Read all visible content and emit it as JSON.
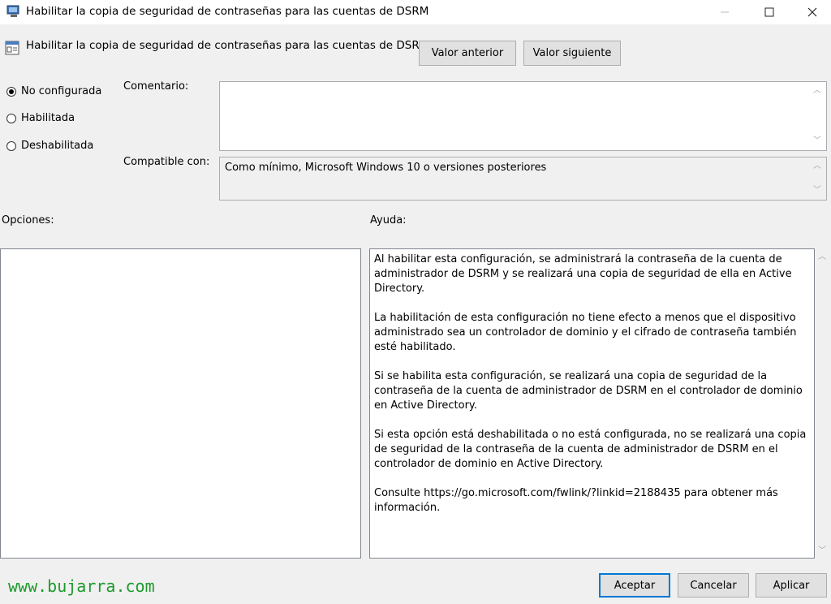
{
  "window": {
    "title": "Habilitar la copia de seguridad de contraseñas para las cuentas de DSRM",
    "app_icon": "policy-editor-icon",
    "controls": [
      "minimize-icon",
      "maximize-icon",
      "close-icon"
    ]
  },
  "header": {
    "policy_title": "Habilitar la copia de seguridad de contraseñas para las cuentas de DSRM",
    "prev_label": "Valor anterior",
    "next_label": "Valor siguiente"
  },
  "state": {
    "options": [
      {
        "label": "No configurada",
        "checked": true
      },
      {
        "label": "Habilitada",
        "checked": false
      },
      {
        "label": "Deshabilitada",
        "checked": false
      }
    ]
  },
  "comment": {
    "label": "Comentario:",
    "value": ""
  },
  "compatible": {
    "label": "Compatible con:",
    "value": "Como mínimo, Microsoft Windows 10 o versiones posteriores"
  },
  "options_panel": {
    "label": "Opciones:"
  },
  "help_panel": {
    "label": "Ayuda:",
    "paragraphs": [
      "Al habilitar esta configuración, se administrará la contraseña de la cuenta de administrador de DSRM y se realizará una copia de seguridad de ella en Active Directory.",
      "La habilitación de esta configuración no tiene efecto a menos que el dispositivo administrado sea un controlador de dominio y el cifrado de contraseña también esté habilitado.",
      "Si se habilita esta configuración, se realizará una copia de seguridad de la contraseña de la cuenta de administrador de DSRM en el controlador de dominio en Active Directory.",
      "Si esta opción está deshabilitada o no está configurada, no se realizará una copia de seguridad de la contraseña de la cuenta de administrador de DSRM en el controlador de dominio en Active Directory.",
      "Consulte https://go.microsoft.com/fwlink/?linkid=2188435 para obtener más información."
    ]
  },
  "footer": {
    "ok_label": "Aceptar",
    "cancel_label": "Cancelar",
    "apply_label": "Aplicar"
  },
  "watermark": "www.bujarra.com",
  "colors": {
    "accent": "#0078d7",
    "watermark": "#1c9b2c",
    "background": "#f0f0f0"
  }
}
